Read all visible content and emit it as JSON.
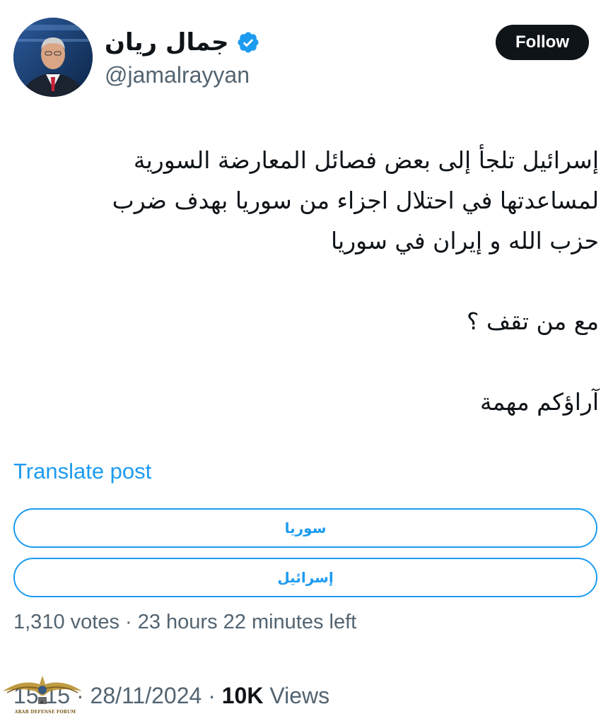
{
  "author": {
    "display_name": "جمال ريان",
    "handle": "@jamalrayyan",
    "verified": true,
    "verified_icon": "verified-badge-icon"
  },
  "follow_button": {
    "label": "Follow"
  },
  "post": {
    "lines": [
      "إسرائيل تلجأ إلى بعض فصائل المعارضة السورية",
      "لمساعدتها في احتلال اجزاء من سوريا بهدف ضرب",
      "حزب الله و إيران في سوريا",
      "مع من تقف ؟",
      "آراؤكم مهمة"
    ]
  },
  "translate_link": "Translate post",
  "poll": {
    "options": [
      "سوريا",
      "إسرائيل"
    ],
    "meta": "1,310 votes · 23 hours 22 minutes left"
  },
  "timestamp": {
    "time": "15:15",
    "separator": " · ",
    "date": "28/11/2024",
    "views_count": "10K",
    "views_label": " Views"
  },
  "watermark": {
    "text": "ARAB DEFENSE FORUM"
  },
  "colors": {
    "accent": "#1d9bf0",
    "text": "#0f1419",
    "secondary": "#536471",
    "follow_bg": "#0f1419"
  }
}
